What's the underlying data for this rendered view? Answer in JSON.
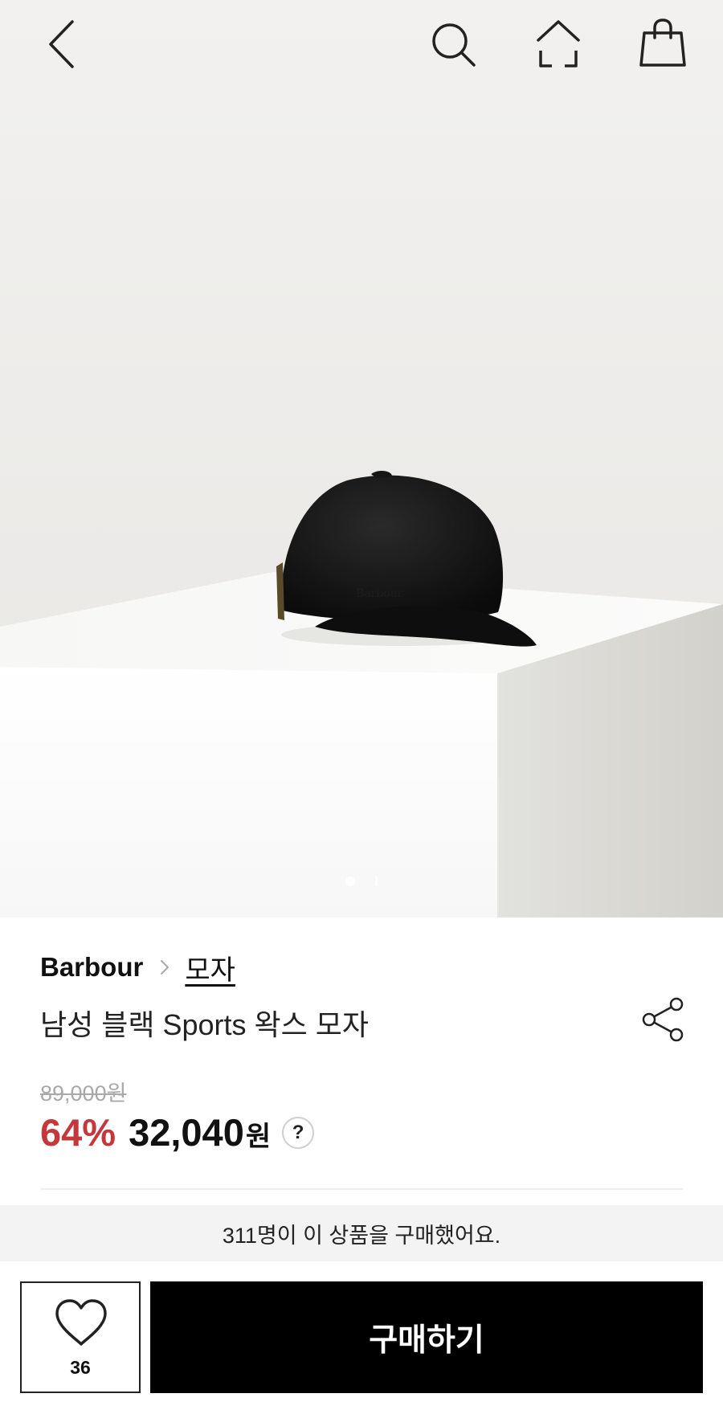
{
  "header": {
    "icons": [
      "back-icon",
      "search-icon",
      "home-icon",
      "shopping-bag-icon"
    ]
  },
  "gallery": {
    "image": "black baseball cap on white pedestal",
    "cap_logo": "Barbour",
    "page_count": 2,
    "active_page": 1
  },
  "product": {
    "brand": "Barbour",
    "category": "모자",
    "name": "남성 블랙 Sports 왁스 모자",
    "original_price": "89,000원",
    "discount": "64%",
    "price": "32,040",
    "currency": "원",
    "help_label": "?"
  },
  "notice": {
    "purchase_text": "311명이 이 상품을 구매했어요."
  },
  "actions": {
    "like_count": "36",
    "buy_label": "구매하기"
  },
  "colors": {
    "discount": "#c4383b",
    "buy_button": "#000000",
    "notice_bg": "#f3f3f3"
  }
}
